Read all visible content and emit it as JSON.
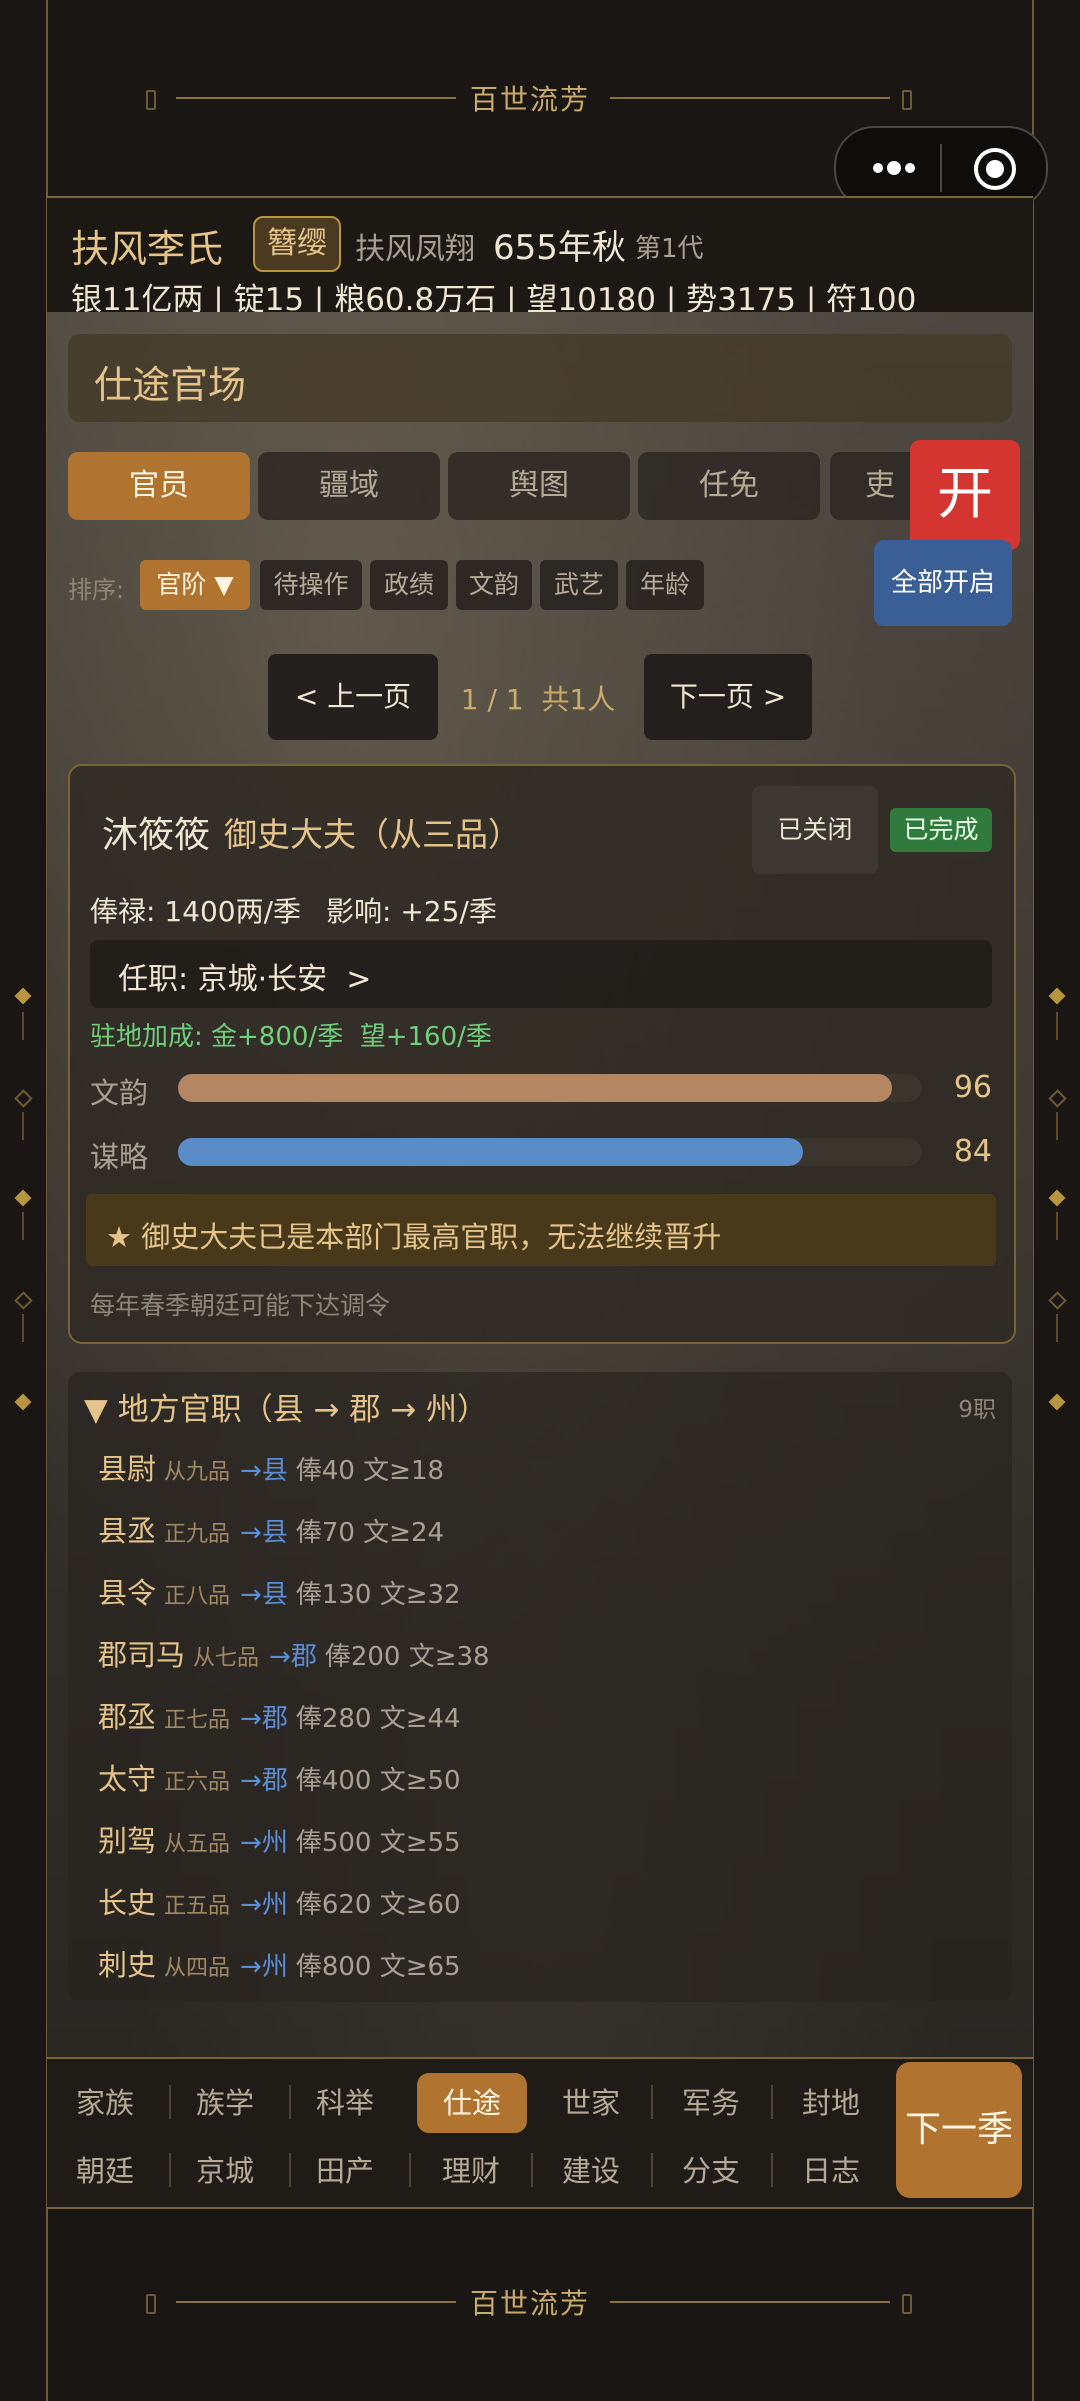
{
  "app": {
    "title": "百世流芳",
    "footer_title": "百世流芳"
  },
  "header": {
    "family_name": "扶风李氏",
    "badge": "簪缨",
    "motto": "扶风凤翔",
    "year": "655年秋",
    "generation": "第1代",
    "stats": "银11亿两 | 锭15 | 粮60.8万石 | 望10180 | 势3175 | 符100"
  },
  "section": {
    "title": "仕途官场"
  },
  "tabs": [
    {
      "label": "官员",
      "active": true
    },
    {
      "label": "疆域"
    },
    {
      "label": "舆图"
    },
    {
      "label": "任免"
    },
    {
      "label": "吏"
    }
  ],
  "float_buttons": {
    "open": "开",
    "open_all": "全部开启"
  },
  "sort": {
    "label": "排序:",
    "options": [
      "官阶 ▼",
      "待操作",
      "政绩",
      "文韵",
      "武艺",
      "年龄"
    ]
  },
  "pager": {
    "prev": "< 上一页",
    "info": "1 / 1  共1人",
    "next": "下一页 >"
  },
  "official": {
    "name": "沐筱筱",
    "title": "御史大夫（从三品）",
    "closed_label": "已关闭",
    "done_label": "已完成",
    "salary": "俸禄: 1400两/季",
    "influence": "影响: +25/季",
    "post": "任职: 京城·长安  >",
    "bonus": "驻地加成: 金+800/季  望+160/季",
    "attrs": [
      {
        "label": "文韵",
        "value": 96,
        "max": 100,
        "color": "#b58662"
      },
      {
        "label": "谋略",
        "value": 84,
        "max": 100,
        "color": "#5a8cc7"
      }
    ],
    "notice": "★ 御史大夫已是本部门最高官职，无法继续晋升",
    "hint": "每年春季朝廷可能下达调令"
  },
  "ranks": {
    "title": "▼ 地方官职（县 → 郡 → 州）",
    "count": "9职",
    "items": [
      {
        "name": "县尉",
        "grade": "从九品",
        "arrow": "→县",
        "info": "俸40 文≥18"
      },
      {
        "name": "县丞",
        "grade": "正九品",
        "arrow": "→县",
        "info": "俸70 文≥24"
      },
      {
        "name": "县令",
        "grade": "正八品",
        "arrow": "→县",
        "info": "俸130 文≥32"
      },
      {
        "name": "郡司马",
        "grade": "从七品",
        "arrow": "→郡",
        "info": "俸200 文≥38"
      },
      {
        "name": "郡丞",
        "grade": "正七品",
        "arrow": "→郡",
        "info": "俸280 文≥44"
      },
      {
        "name": "太守",
        "grade": "正六品",
        "arrow": "→郡",
        "info": "俸400 文≥50"
      },
      {
        "name": "别驾",
        "grade": "从五品",
        "arrow": "→州",
        "info": "俸500 文≥55"
      },
      {
        "name": "长史",
        "grade": "正五品",
        "arrow": "→州",
        "info": "俸620 文≥60"
      },
      {
        "name": "刺史",
        "grade": "从四品",
        "arrow": "→州",
        "info": "俸800 文≥65"
      }
    ]
  },
  "nav": {
    "row1": [
      "家族",
      "族学",
      "科举",
      "仕途",
      "世家",
      "军务",
      "封地"
    ],
    "row2": [
      "朝廷",
      "京城",
      "田产",
      "理财",
      "建设",
      "分支",
      "日志"
    ],
    "active": "仕途",
    "next_season": "下一季"
  }
}
